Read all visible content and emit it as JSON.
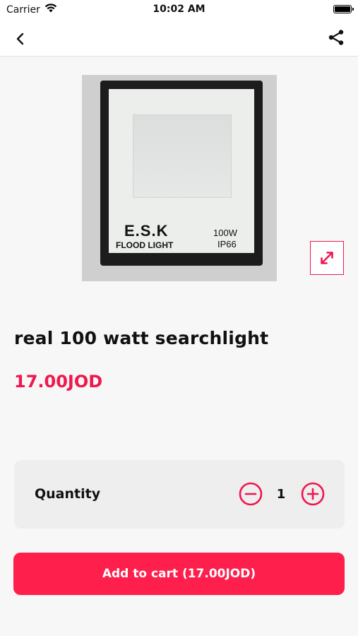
{
  "status": {
    "carrier": "Carrier",
    "time": "10:02 AM"
  },
  "nav": {
    "back_icon": "chevron-left-icon",
    "share_icon": "share-icon"
  },
  "image": {
    "brand_text": "E.S.K",
    "subtitle_text": "FLOOD LIGHT",
    "wattage_text": "100W",
    "rating_text": "IP66",
    "expand_icon": "expand-arrows-icon"
  },
  "product": {
    "title": "real 100 watt searchlight",
    "price": "17.00JOD"
  },
  "quantity": {
    "label": "Quantity",
    "value": "1"
  },
  "cart": {
    "button_label": "Add to cart (17.00JOD)"
  },
  "colors": {
    "accent": "#f0174e",
    "button": "#fe1f4c"
  }
}
